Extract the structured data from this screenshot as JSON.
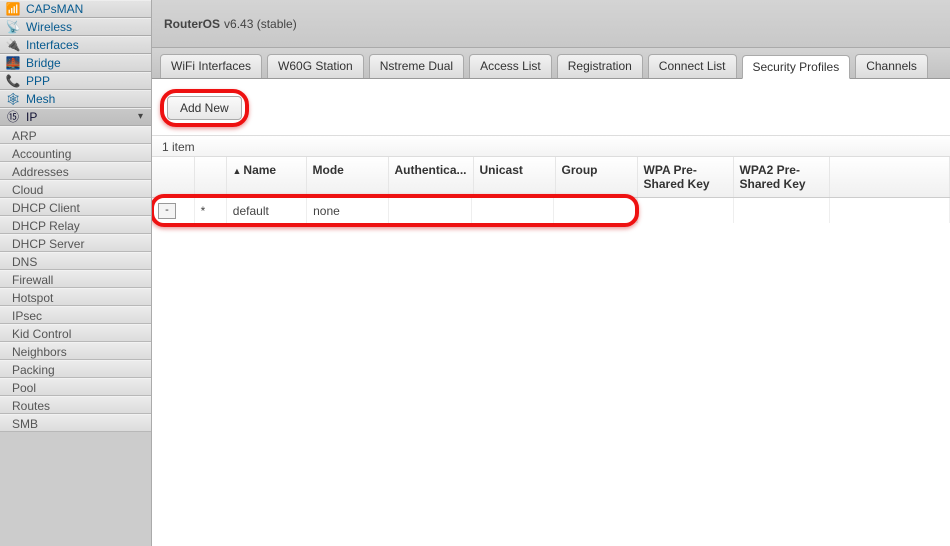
{
  "sidebar": {
    "items": [
      {
        "label": "CAPsMAN",
        "icon": "📶"
      },
      {
        "label": "Wireless",
        "icon": "📡"
      },
      {
        "label": "Interfaces",
        "icon": "🔌"
      },
      {
        "label": "Bridge",
        "icon": "🌉"
      },
      {
        "label": "PPP",
        "icon": "📞"
      },
      {
        "label": "Mesh",
        "icon": "🕸"
      }
    ],
    "ip_label": "IP",
    "ip_icon": "⑮",
    "ip_sub": [
      "ARP",
      "Accounting",
      "Addresses",
      "Cloud",
      "DHCP Client",
      "DHCP Relay",
      "DHCP Server",
      "DNS",
      "Firewall",
      "Hotspot",
      "IPsec",
      "Kid Control",
      "Neighbors",
      "Packing",
      "Pool",
      "Routes",
      "SMB"
    ]
  },
  "header": {
    "title_bold": "RouterOS",
    "version": "v6.43 (stable)"
  },
  "tabs": [
    {
      "label": "WiFi Interfaces"
    },
    {
      "label": "W60G Station"
    },
    {
      "label": "Nstreme Dual"
    },
    {
      "label": "Access List"
    },
    {
      "label": "Registration"
    },
    {
      "label": "Connect List"
    },
    {
      "label": "Security Profiles",
      "active": true
    },
    {
      "label": "Channels"
    }
  ],
  "toolbar": {
    "add_new": "Add New"
  },
  "count_text": "1 item",
  "columns": {
    "c0": "",
    "c1": "",
    "name": "Name",
    "mode": "Mode",
    "auth": "Authentica...",
    "unicast": "Unicast",
    "group": "Group",
    "wpa": "WPA Pre-Shared Key",
    "wpa2": "WPA2 Pre-Shared Key"
  },
  "row": {
    "minus": "-",
    "flag": "*",
    "name": "default",
    "mode": "none",
    "auth": "",
    "unicast": "",
    "group": "",
    "wpa": "",
    "wpa2": ""
  }
}
